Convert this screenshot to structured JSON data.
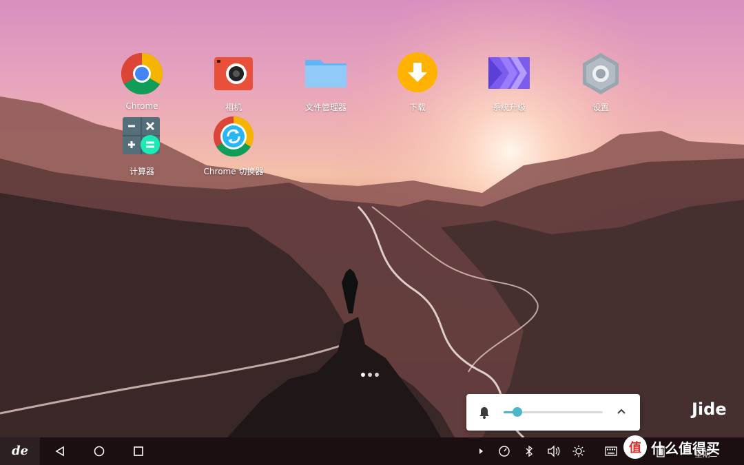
{
  "desktop": {
    "apps": [
      {
        "label": "Chrome",
        "icon": "chrome-icon"
      },
      {
        "label": "相机",
        "icon": "camera-icon"
      },
      {
        "label": "文件管理器",
        "icon": "folder-icon"
      },
      {
        "label": "下载",
        "icon": "download-icon"
      },
      {
        "label": "系统升级",
        "icon": "system-upgrade-icon"
      },
      {
        "label": "设置",
        "icon": "settings-icon"
      },
      {
        "label": "计算器",
        "icon": "calculator-icon"
      },
      {
        "label": "Chrome 切换器",
        "icon": "chrome-switcher-icon"
      }
    ],
    "page_indicator": {
      "pages": 3,
      "current": 1
    }
  },
  "volume_popup": {
    "level": 0.14,
    "bell_icon": "bell-icon",
    "collapse_icon": "chevron-up-icon"
  },
  "watermark": "Jide",
  "taskbar": {
    "start_label": "de",
    "nav_icons": [
      "back-icon",
      "home-icon",
      "recents-icon"
    ],
    "tray_icons": [
      "expand-tray-icon",
      "speedometer-icon",
      "bluetooth-icon",
      "volume-icon",
      "brightness-icon",
      "keyboard-icon",
      "battery-icon"
    ],
    "clock_day": "星期二"
  },
  "brand_badge": {
    "symbol": "值",
    "text": "什么值得买"
  },
  "colors": {
    "taskbar": "#1b0f11",
    "accent": "#4db6c8"
  }
}
